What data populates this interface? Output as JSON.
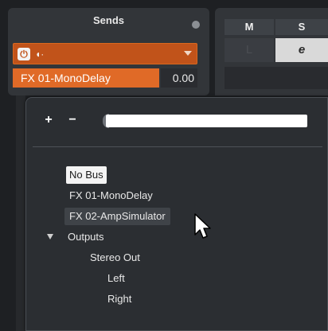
{
  "sends": {
    "title": "Sends",
    "slot": {
      "power_icon": "power-icon",
      "prepost_icon": "pre-post-fader-icon",
      "dropdown_icon": "chevron-down-icon",
      "name": "FX 01-MonoDelay",
      "level": "0.00"
    }
  },
  "mixer": {
    "mute_header": "M",
    "solo_header": "S",
    "listen_label": "L",
    "edit_label": "e"
  },
  "popup": {
    "add_label": "+",
    "remove_label": "−",
    "search_value": "",
    "items": [
      {
        "label": "No Bus",
        "state": "current"
      },
      {
        "label": "FX 01-MonoDelay",
        "state": "normal"
      },
      {
        "label": "FX 02-AmpSimulator",
        "state": "hover"
      },
      {
        "label": "Outputs",
        "state": "expanded-folder"
      },
      {
        "label": "Stereo Out",
        "state": "normal"
      },
      {
        "label": "Left",
        "state": "normal"
      },
      {
        "label": "Right",
        "state": "normal"
      }
    ]
  },
  "colors": {
    "accent_orange": "#e06a27",
    "panel_bg": "#323539",
    "popup_bg": "#2b2e32"
  }
}
